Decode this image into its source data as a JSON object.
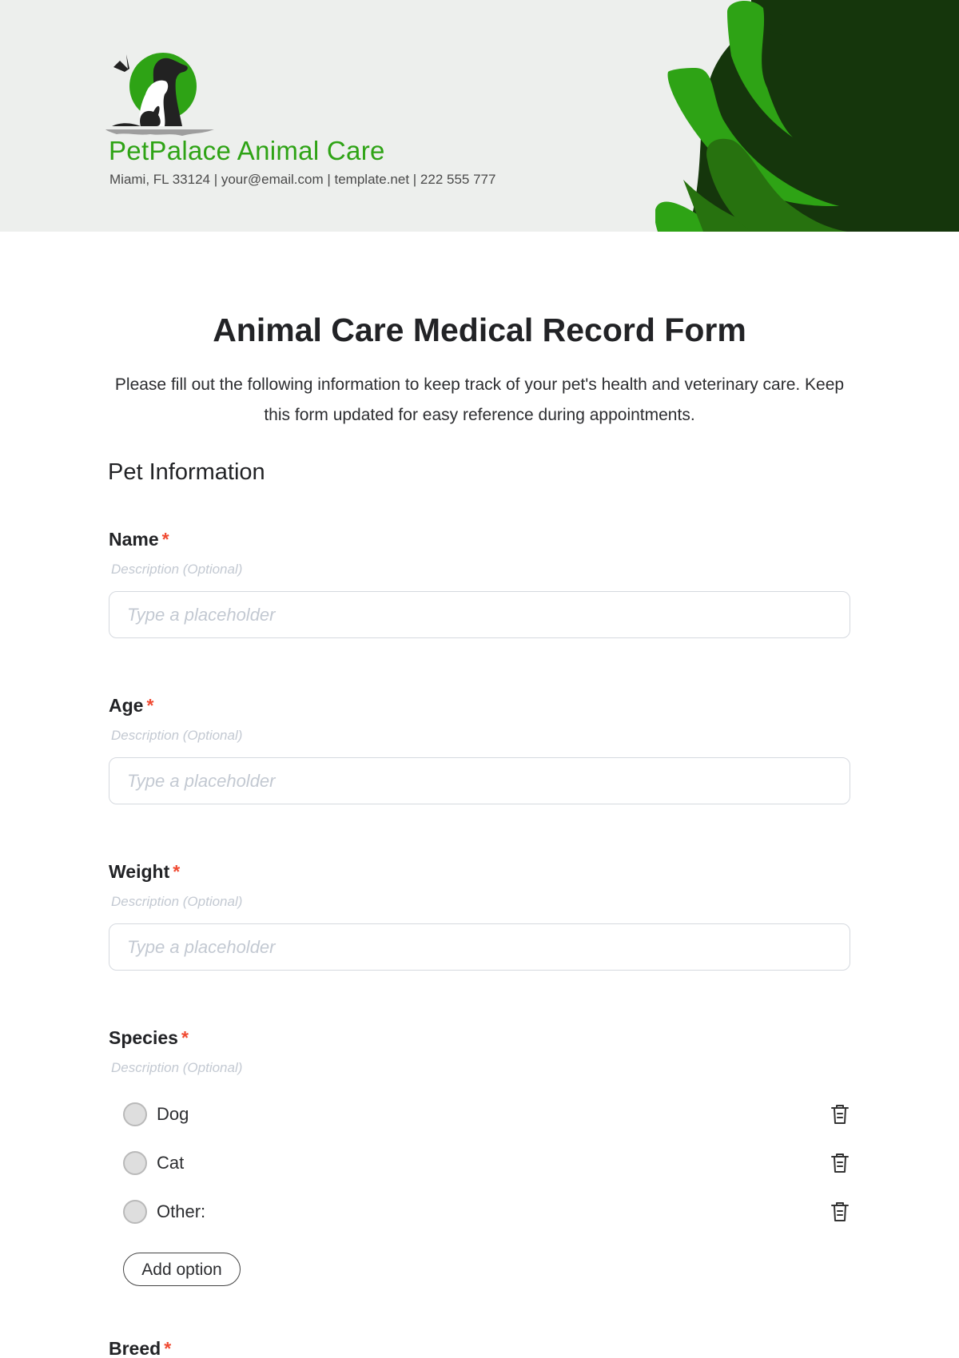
{
  "header": {
    "brand_name": "PetPalace Animal Care",
    "contact": "Miami, FL 33124 | your@email.com | template.net | 222 555 777",
    "logo_icon": "pet-silhouettes-logo",
    "colors": {
      "brand_green": "#2ea315",
      "dark_green": "#15360c",
      "mid_green": "#27720f",
      "header_bg": "#edefed"
    }
  },
  "form": {
    "title": "Animal Care Medical Record Form",
    "intro": "Please fill out the following information to keep track of your pet's health and veterinary care. Keep this form updated for easy reference during appointments.",
    "section_title": "Pet Information",
    "required_marker": "*",
    "fields": [
      {
        "label": "Name",
        "required": true,
        "description": "Description (Optional)",
        "placeholder": "Type a placeholder"
      },
      {
        "label": "Age",
        "required": true,
        "description": "Description (Optional)",
        "placeholder": "Type a placeholder"
      },
      {
        "label": "Weight",
        "required": true,
        "description": "Description (Optional)",
        "placeholder": "Type a placeholder"
      }
    ],
    "species": {
      "label": "Species",
      "required": true,
      "description": "Description (Optional)",
      "options": [
        {
          "label": "Dog",
          "selected": false
        },
        {
          "label": "Cat",
          "selected": false
        },
        {
          "label": "Other:",
          "selected": false
        }
      ],
      "delete_icon": "trash-icon",
      "add_option_label": "Add option"
    },
    "breed": {
      "label": "Breed",
      "required": true
    }
  }
}
